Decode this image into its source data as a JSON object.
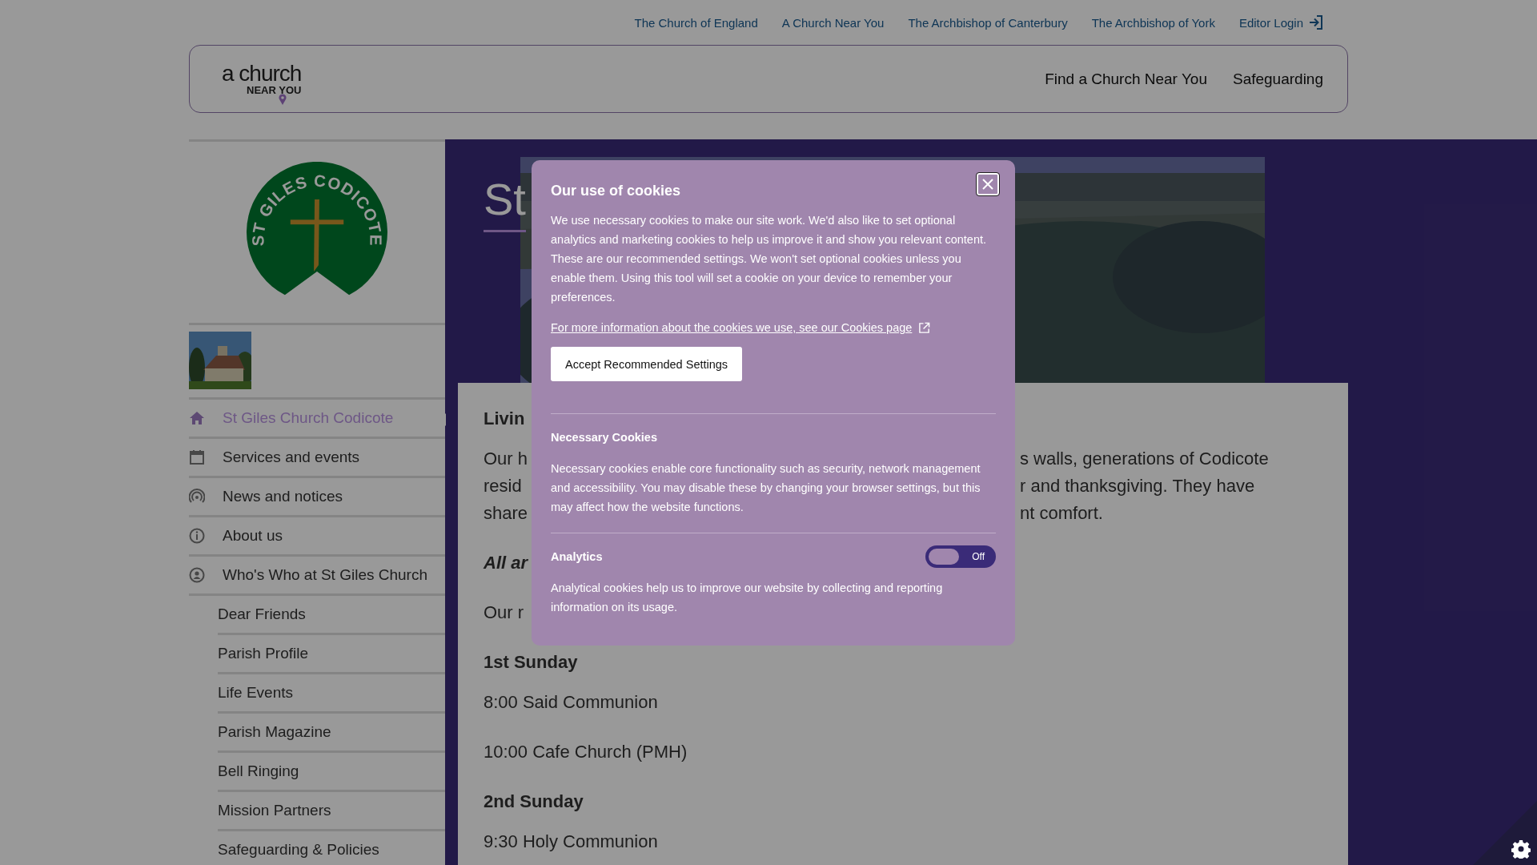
{
  "top_links": [
    {
      "label": "The Church of England",
      "kind": "link"
    },
    {
      "label": "A Church Near You",
      "kind": "link"
    },
    {
      "label": "The Archbishop of Canterbury",
      "kind": "link"
    },
    {
      "label": "The Archbishop of York",
      "kind": "link"
    },
    {
      "label": "Editor Login",
      "kind": "login"
    }
  ],
  "header": {
    "logo": {
      "line1": "a church",
      "line2": "NEAR YOU"
    },
    "nav": [
      "Find a Church Near You",
      "Safeguarding"
    ]
  },
  "sidebar": {
    "logo_text": "ST GILES CODICOTE",
    "items": [
      {
        "label": "St Giles Church Codicote",
        "kind": "home",
        "selected": true
      },
      {
        "label": "Services and events",
        "kind": "calendar",
        "selected": false
      },
      {
        "label": "News and notices",
        "kind": "broadcast",
        "selected": false
      },
      {
        "label": "About us",
        "kind": "info",
        "selected": false
      },
      {
        "label": "Who's Who at St Giles Church",
        "kind": "person",
        "selected": false,
        "children": [
          {
            "label": "Dear Friends",
            "selected": false
          },
          {
            "label": "Parish Profile",
            "selected": false
          },
          {
            "label": "Life Events",
            "selected": false
          },
          {
            "label": "Parish Magazine",
            "selected": false
          },
          {
            "label": "Bell Ringing",
            "selected": false
          },
          {
            "label": "Mission Partners",
            "selected": false
          },
          {
            "label": "Safeguarding & Policies",
            "selected": false
          }
        ]
      }
    ]
  },
  "main": {
    "title": "St",
    "content": [
      {
        "kind": "heading",
        "lines": [
          {
            "left": "Livin"
          }
        ]
      },
      {
        "kind": "text",
        "lines": [
          {
            "left": "Our h",
            "right": "s walls, generations of Codicote"
          },
          {
            "left": "resid",
            "right": "r and thanksgiving. They have"
          },
          {
            "left": "share",
            "right": "nt comfort."
          }
        ]
      },
      {
        "kind": "emphasis",
        "lines": [
          {
            "left": "All ar"
          }
        ]
      },
      {
        "kind": "text",
        "lines": [
          {
            "left": "Our r"
          }
        ]
      },
      {
        "kind": "heading",
        "lines": [
          {
            "left": "1st Sunday"
          }
        ]
      },
      {
        "kind": "text",
        "lines": [
          {
            "left": "8:00 Said Communion"
          }
        ]
      },
      {
        "kind": "text",
        "lines": [
          {
            "left": "10:00 Cafe Church (PMH)"
          }
        ]
      },
      {
        "kind": "heading",
        "lines": [
          {
            "left": "2nd Sunday"
          }
        ]
      },
      {
        "kind": "text",
        "lines": [
          {
            "left": "9:30 Holy Communion"
          }
        ]
      }
    ]
  },
  "cookie_dialog": {
    "title": "Our use of cookies",
    "intro": "We use necessary cookies to make our site work. We'd also like to set optional analytics and marketing cookies to help us improve it and show you relevant content. These are our recommended settings. We won't set optional cookies unless you enable them. Using this tool will set a cookie on your device to remember your preferences.",
    "link": "For more information about the cookies we use, see our Cookies page",
    "accept_button": "Accept Recommended Settings",
    "sections": [
      {
        "kind": "fixed",
        "title": "Necessary Cookies",
        "text": "Necessary cookies enable core functionality such as security, network management and accessibility. You may disable these by changing your browser settings, but this may affect how the website functions."
      },
      {
        "kind": "toggle",
        "title": "Analytics",
        "on": false,
        "state_label": "Off",
        "text": "Analytical cookies help us to improve our website by collecting and reporting information on its usage."
      }
    ]
  }
}
